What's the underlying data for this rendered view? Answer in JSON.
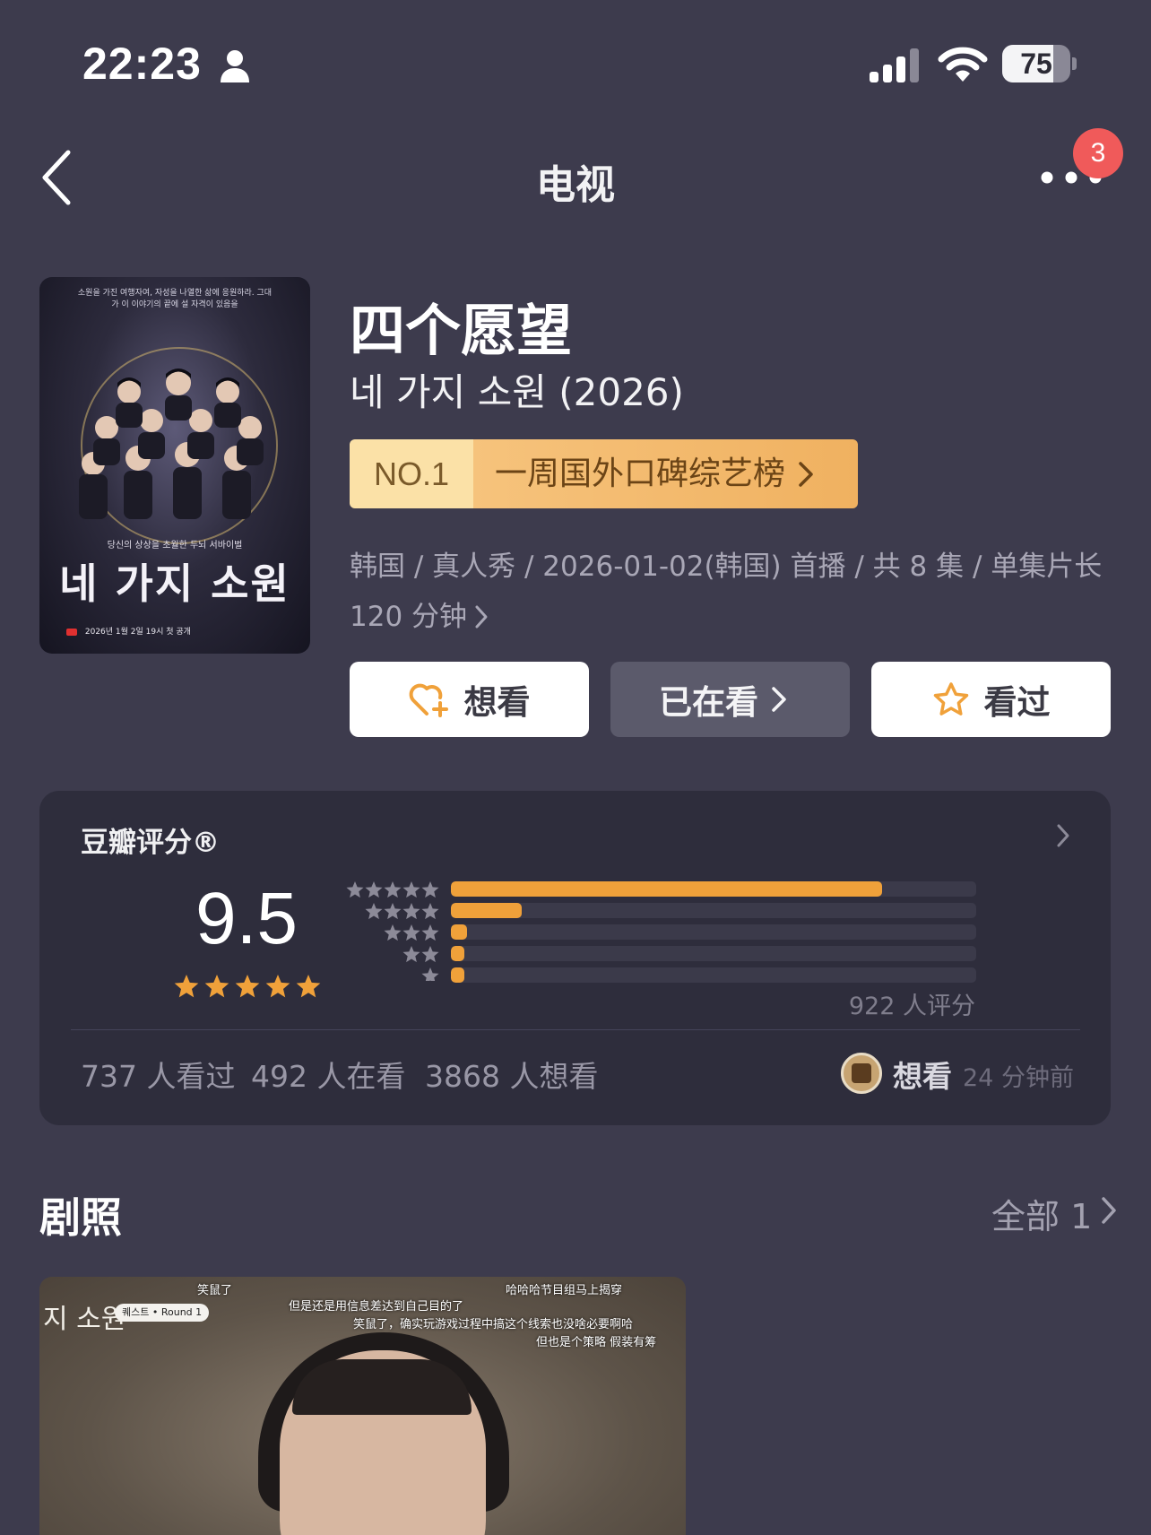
{
  "status_bar": {
    "time": "22:23",
    "battery_level": 75,
    "battery_text": "75",
    "icons": [
      "person-icon",
      "signal-icon",
      "wifi-icon",
      "battery-icon"
    ]
  },
  "nav": {
    "title": "电视",
    "back_icon": "chevron-left-icon",
    "more_icon": "more-icon",
    "notification_count": "3"
  },
  "poster": {
    "tagline": "소원을 가진 여행자여, 자성을 나열한 삶에 응원하라. 그대가 이 이야기의 끝에 설 자격이 있음을",
    "subline": "당신의 상상을 초월한 두뇌 서바이벌",
    "title": "네 가지 소원",
    "footer": "2026년 1월 2일 19시 첫 공개"
  },
  "show": {
    "title": "四个愿望",
    "original_title": "네 가지 소원 (2026)",
    "rank": {
      "position": "NO.1",
      "list_name": "一周国外口碑综艺榜"
    },
    "meta": "韩国 / 真人秀 / 2026-01-02(韩国) 首播 / 共 8 集 / 单集片长 120 分钟"
  },
  "actions": {
    "want": "想看",
    "watching": "已在看",
    "watched": "看过"
  },
  "rating": {
    "label": "豆瓣评分®",
    "score": "9.5",
    "score_stars": 5,
    "distribution": [
      {
        "stars": 5,
        "fraction": 0.82
      },
      {
        "stars": 4,
        "fraction": 0.135
      },
      {
        "stars": 3,
        "fraction": 0.03
      },
      {
        "stars": 2,
        "fraction": 0.025
      },
      {
        "stars": 1,
        "fraction": 0.025
      }
    ],
    "count_text": "922 人评分",
    "stats": {
      "watched": "737 人看过",
      "watching": "492 人在看",
      "want": "3868 人想看"
    },
    "friend": {
      "action": "想看",
      "time": "24 分钟前"
    },
    "colors": {
      "star": "#f0a13a",
      "bar_fill": "#f0a13a",
      "bar_track": "#3b3a4a"
    }
  },
  "stills": {
    "title": "剧照",
    "all_label": "全部 1",
    "image": {
      "logo": "지 소원",
      "chip": "퀘스트 • Round 1",
      "captions": [
        "笑鼠了",
        "哈哈哈节目组马上揭穿",
        "但是还是用信息差达到自己目的了",
        "笑鼠了，确实玩游戏过程中搞这个线索也没啥必要啊哈",
        "但也是个策略 假装有筹"
      ]
    }
  }
}
